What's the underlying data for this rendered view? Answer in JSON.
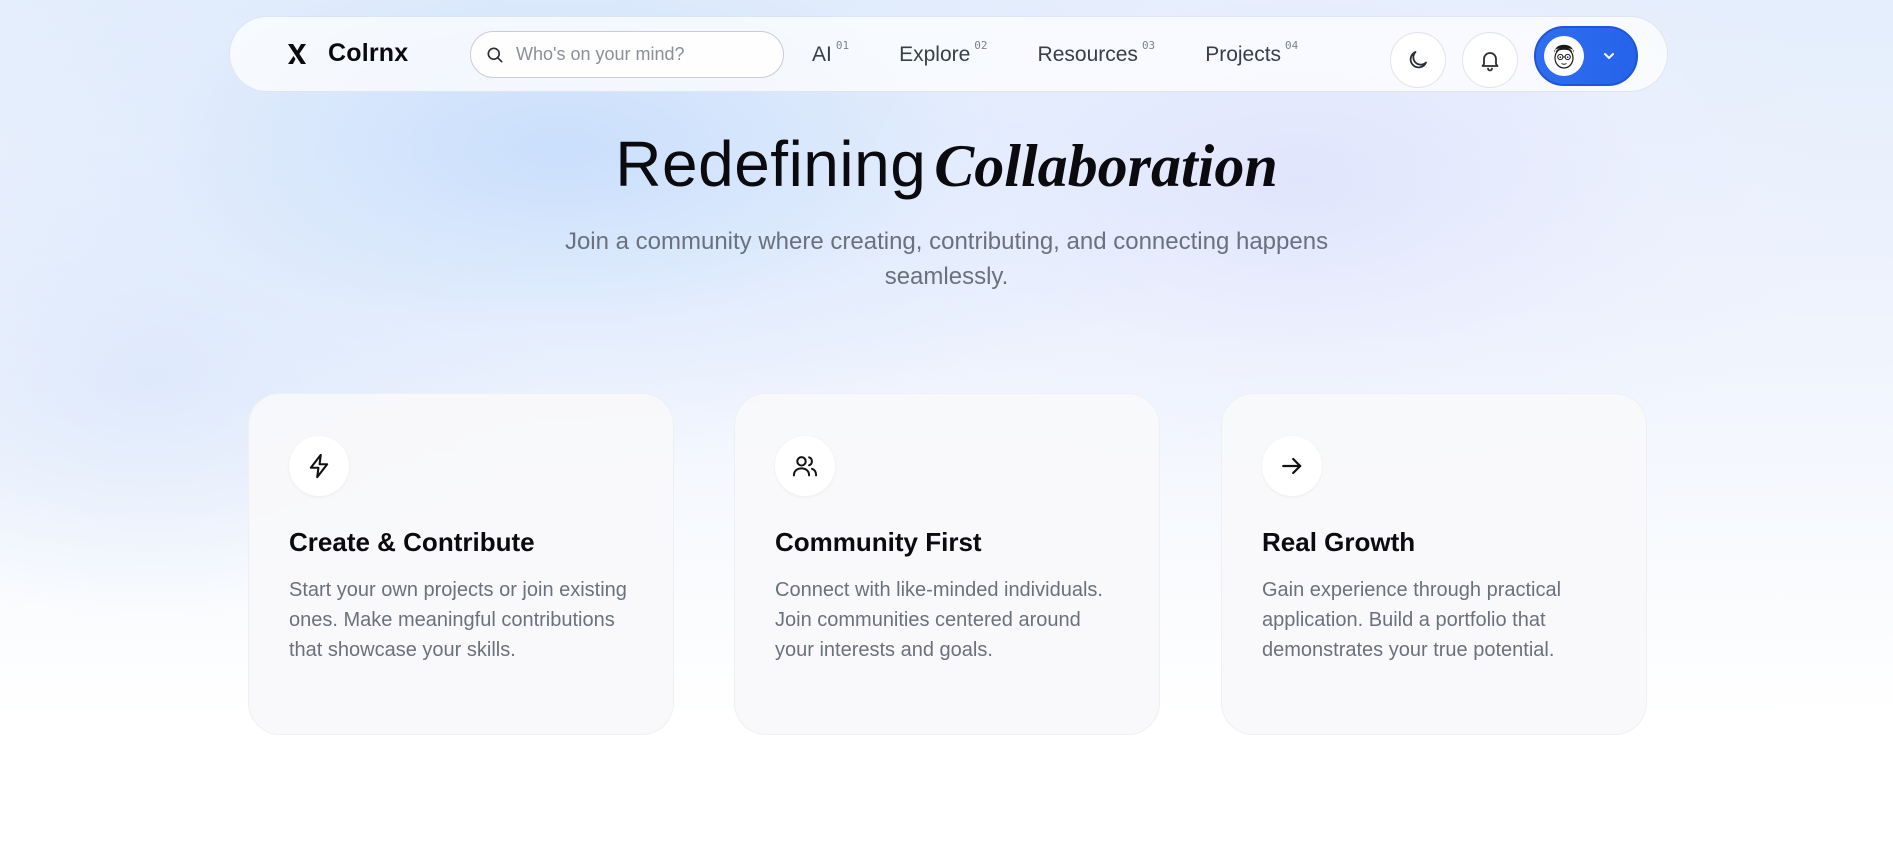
{
  "app": {
    "brand": "Colrnx"
  },
  "search": {
    "placeholder": "Who's on your mind?",
    "value": ""
  },
  "menu": [
    {
      "label": "AI",
      "index": "01"
    },
    {
      "label": "Explore",
      "index": "02"
    },
    {
      "label": "Resources",
      "index": "03"
    },
    {
      "label": "Projects",
      "index": "04"
    }
  ],
  "actions": {
    "theme_icon": "moon-icon",
    "notifications_icon": "bell-icon",
    "profile_icon": "chevron-down-icon"
  },
  "hero": {
    "title_main": "Redefining",
    "title_accent": "Collaboration",
    "subtitle": "Join a community where creating, contributing, and connecting happens seamlessly."
  },
  "features": [
    {
      "icon": "lightning-icon",
      "title": "Create & Contribute",
      "description": "Start your own projects or join existing ones. Make meaningful contributions that showcase your skills."
    },
    {
      "icon": "users-icon",
      "title": "Community First",
      "description": "Connect with like-minded individuals. Join communities centered around your interests and goals."
    },
    {
      "icon": "arrow-right-icon",
      "title": "Real Growth",
      "description": "Gain experience through practical application. Build a portfolio that demonstrates your true potential."
    }
  ],
  "colors": {
    "accent": "#2563eb",
    "text": "#0b0b0f",
    "muted": "#6b717c"
  }
}
